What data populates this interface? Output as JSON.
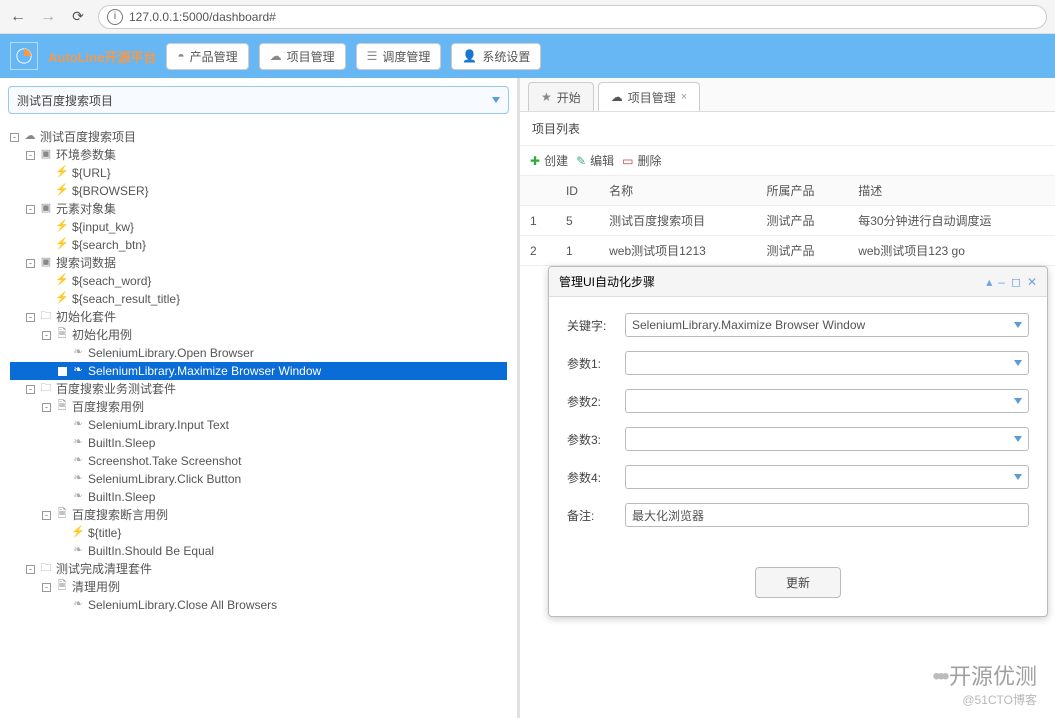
{
  "browser": {
    "url": "127.0.0.1:5000/dashboard#"
  },
  "header": {
    "brand": "AutoLine开源平台",
    "buttons": {
      "product": "产品管理",
      "project": "项目管理",
      "schedule": "调度管理",
      "settings": "系统设置"
    }
  },
  "project_selected": "测试百度搜索项目",
  "tree": [
    {
      "ind": 0,
      "t": "-",
      "ic": "cloud",
      "label": "测试百度搜索项目"
    },
    {
      "ind": 1,
      "t": "-",
      "ic": "case",
      "label": "环境参数集"
    },
    {
      "ind": 2,
      "t": "",
      "ic": "bolt",
      "label": "${URL}"
    },
    {
      "ind": 2,
      "t": "",
      "ic": "bolt",
      "label": "${BROWSER}"
    },
    {
      "ind": 1,
      "t": "-",
      "ic": "case",
      "label": "元素对象集"
    },
    {
      "ind": 2,
      "t": "",
      "ic": "bolt",
      "label": "${input_kw}"
    },
    {
      "ind": 2,
      "t": "",
      "ic": "bolt",
      "label": "${search_btn}"
    },
    {
      "ind": 1,
      "t": "-",
      "ic": "case",
      "label": "搜索词数据"
    },
    {
      "ind": 2,
      "t": "",
      "ic": "bolt",
      "label": "${seach_word}"
    },
    {
      "ind": 2,
      "t": "",
      "ic": "bolt",
      "label": "${seach_result_title}"
    },
    {
      "ind": 1,
      "t": "-",
      "ic": "fold",
      "label": "初始化套件"
    },
    {
      "ind": 2,
      "t": "-",
      "ic": "file",
      "label": "初始化用例"
    },
    {
      "ind": 3,
      "t": "",
      "ic": "leaf",
      "label": "SeleniumLibrary.Open Browser"
    },
    {
      "ind": 3,
      "t": "",
      "ic": "leaf",
      "label": "SeleniumLibrary.Maximize Browser Window",
      "sel": true
    },
    {
      "ind": 1,
      "t": "-",
      "ic": "fold",
      "label": "百度搜索业务测试套件"
    },
    {
      "ind": 2,
      "t": "-",
      "ic": "file",
      "label": "百度搜索用例"
    },
    {
      "ind": 3,
      "t": "",
      "ic": "leaf",
      "label": "SeleniumLibrary.Input Text"
    },
    {
      "ind": 3,
      "t": "",
      "ic": "leaf",
      "label": "BuiltIn.Sleep"
    },
    {
      "ind": 3,
      "t": "",
      "ic": "leaf",
      "label": "Screenshot.Take Screenshot"
    },
    {
      "ind": 3,
      "t": "",
      "ic": "leaf",
      "label": "SeleniumLibrary.Click Button"
    },
    {
      "ind": 3,
      "t": "",
      "ic": "leaf",
      "label": "BuiltIn.Sleep"
    },
    {
      "ind": 2,
      "t": "-",
      "ic": "file",
      "label": "百度搜索断言用例"
    },
    {
      "ind": 3,
      "t": "",
      "ic": "bolt",
      "label": "${title}"
    },
    {
      "ind": 3,
      "t": "",
      "ic": "leaf",
      "label": "BuiltIn.Should Be Equal"
    },
    {
      "ind": 1,
      "t": "-",
      "ic": "fold",
      "label": "测试完成清理套件"
    },
    {
      "ind": 2,
      "t": "-",
      "ic": "file",
      "label": "清理用例"
    },
    {
      "ind": 3,
      "t": "",
      "ic": "leaf",
      "label": "SeleniumLibrary.Close All Browsers"
    }
  ],
  "tabs": {
    "start": "开始",
    "project": "项目管理"
  },
  "list_title": "项目列表",
  "toolbar": {
    "create": "创建",
    "edit": "编辑",
    "delete": "删除"
  },
  "table": {
    "headers": [
      "",
      "ID",
      "名称",
      "所属产品",
      "描述"
    ],
    "rows": [
      [
        "1",
        "5",
        "测试百度搜索项目",
        "测试产品",
        "每30分钟进行自动调度运"
      ],
      [
        "2",
        "1",
        "web测试项目1213",
        "测试产品",
        "web测试项目123 go"
      ]
    ]
  },
  "dialog": {
    "title": "管理UI自动化步骤",
    "fields": {
      "keyword_label": "关键字:",
      "keyword_value": "SeleniumLibrary.Maximize Browser Window",
      "p1": "参数1:",
      "p2": "参数2:",
      "p3": "参数3:",
      "p4": "参数4:",
      "remark_label": "备注:",
      "remark_value": "最大化浏览器"
    },
    "button": "更新"
  },
  "watermark": {
    "title": "开源优测",
    "sub": "@51CTO博客"
  }
}
